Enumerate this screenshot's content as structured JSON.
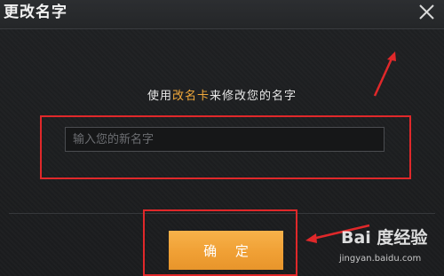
{
  "dialog": {
    "title": "更改名字",
    "prompt_before": "使用",
    "prompt_highlight": "改名卡",
    "prompt_after": "来修改您的名字",
    "name_input": {
      "value": "",
      "placeholder": "输入您的新名字"
    },
    "confirm_label": "确 定",
    "close_icon": "close-icon"
  },
  "annotations": {
    "color": "#e0282a"
  },
  "watermark": {
    "brand_logo_text": "Bai 度经验",
    "url": "jingyan.baidu.com"
  },
  "colors": {
    "background": "#1c1d1f",
    "accent": "#f2a93b",
    "button": "#f0a035"
  }
}
